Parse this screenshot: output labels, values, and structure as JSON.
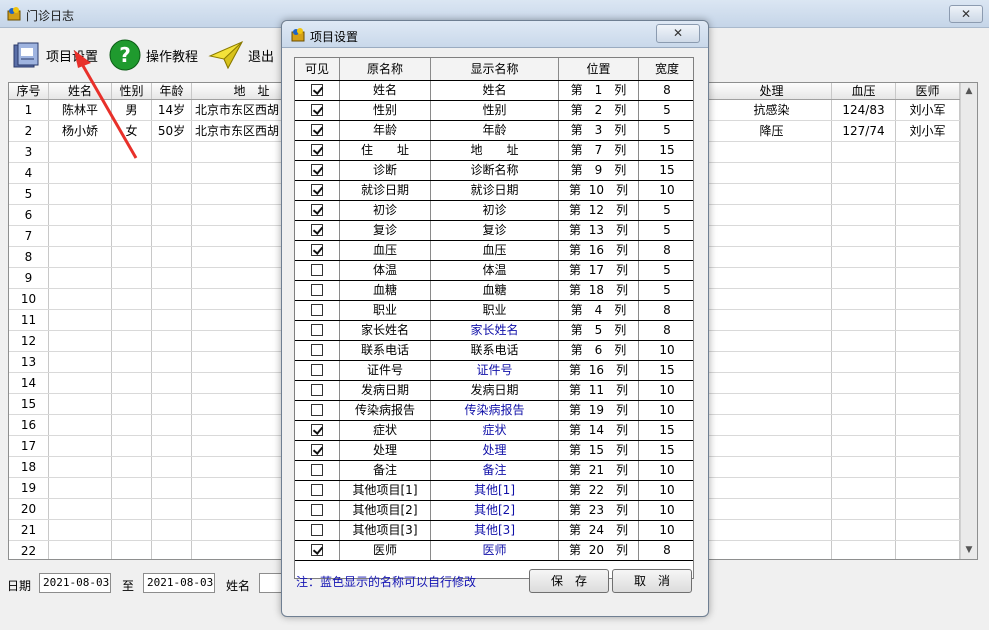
{
  "window": {
    "title": "门诊日志",
    "close_label": "✕"
  },
  "toolbar": [
    {
      "label": "项目设置"
    },
    {
      "label": "操作教程"
    },
    {
      "label": "退出"
    }
  ],
  "grid": {
    "headers": [
      "序号",
      "姓名",
      "性别",
      "年龄",
      "地　址",
      "处理",
      "血压",
      "医师"
    ],
    "rows": [
      {
        "no": "1",
        "name": "陈林平",
        "sex": "男",
        "age": "14岁",
        "address": "北京市东区西胡",
        "treatment": "抗感染",
        "bp": "124/83",
        "doctor": "刘小军"
      },
      {
        "no": "2",
        "name": "杨小娇",
        "sex": "女",
        "age": "50岁",
        "address": "北京市东区西胡",
        "treatment": "降压",
        "bp": "127/74",
        "doctor": "刘小军"
      },
      {
        "no": "3"
      },
      {
        "no": "4"
      },
      {
        "no": "5"
      },
      {
        "no": "6"
      },
      {
        "no": "7"
      },
      {
        "no": "8"
      },
      {
        "no": "9"
      },
      {
        "no": "10"
      },
      {
        "no": "11"
      },
      {
        "no": "12"
      },
      {
        "no": "13"
      },
      {
        "no": "14"
      },
      {
        "no": "15"
      },
      {
        "no": "16"
      },
      {
        "no": "17"
      },
      {
        "no": "18"
      },
      {
        "no": "19"
      },
      {
        "no": "20"
      },
      {
        "no": "21"
      },
      {
        "no": "22"
      }
    ]
  },
  "filter": {
    "date_label": "日期",
    "date_from": "2021-08-03",
    "to_label": "至",
    "date_to": "2021-08-03",
    "name_label": "姓名",
    "name_value": ""
  },
  "dialog": {
    "title": "项目设置",
    "close_label": "✕",
    "headers": [
      "可见",
      "原名称",
      "显示名称",
      "位置",
      "宽度"
    ],
    "items": [
      {
        "visible": true,
        "original": "姓名",
        "display": "姓名",
        "custom": false,
        "position": "第　1　列",
        "width": "8"
      },
      {
        "visible": true,
        "original": "性别",
        "display": "性别",
        "custom": false,
        "position": "第　2　列",
        "width": "5"
      },
      {
        "visible": true,
        "original": "年龄",
        "display": "年龄",
        "custom": false,
        "position": "第　3　列",
        "width": "5"
      },
      {
        "visible": true,
        "original": "住　　址",
        "display": "地　　址",
        "custom": false,
        "position": "第　7　列",
        "width": "15"
      },
      {
        "visible": true,
        "original": "诊断",
        "display": "诊断名称",
        "custom": false,
        "position": "第　9　列",
        "width": "15"
      },
      {
        "visible": true,
        "original": "就诊日期",
        "display": "就诊日期",
        "custom": false,
        "position": "第 10　列",
        "width": "10"
      },
      {
        "visible": true,
        "original": "初诊",
        "display": "初诊",
        "custom": false,
        "position": "第 12　列",
        "width": "5"
      },
      {
        "visible": true,
        "original": "复诊",
        "display": "复诊",
        "custom": false,
        "position": "第 13　列",
        "width": "5"
      },
      {
        "visible": true,
        "original": "血压",
        "display": "血压",
        "custom": false,
        "position": "第 16　列",
        "width": "8"
      },
      {
        "visible": false,
        "original": "体温",
        "display": "体温",
        "custom": false,
        "position": "第 17　列",
        "width": "5"
      },
      {
        "visible": false,
        "original": "血糖",
        "display": "血糖",
        "custom": false,
        "position": "第 18　列",
        "width": "5"
      },
      {
        "visible": false,
        "original": "职业",
        "display": "职业",
        "custom": false,
        "position": "第　4　列",
        "width": "8"
      },
      {
        "visible": false,
        "original": "家长姓名",
        "display": "家长姓名",
        "custom": true,
        "position": "第　5　列",
        "width": "8"
      },
      {
        "visible": false,
        "original": "联系电话",
        "display": "联系电话",
        "custom": false,
        "position": "第　6　列",
        "width": "10"
      },
      {
        "visible": false,
        "original": "证件号",
        "display": "证件号",
        "custom": true,
        "position": "第 16　列",
        "width": "15"
      },
      {
        "visible": false,
        "original": "发病日期",
        "display": "发病日期",
        "custom": false,
        "position": "第 11　列",
        "width": "10"
      },
      {
        "visible": false,
        "original": "传染病报告",
        "display": "传染病报告",
        "custom": true,
        "position": "第 19　列",
        "width": "10"
      },
      {
        "visible": true,
        "original": "症状",
        "display": "症状",
        "custom": true,
        "position": "第 14　列",
        "width": "15"
      },
      {
        "visible": true,
        "original": "处理",
        "display": "处理",
        "custom": true,
        "position": "第 15　列",
        "width": "15"
      },
      {
        "visible": false,
        "original": "备注",
        "display": "备注",
        "custom": true,
        "position": "第 21　列",
        "width": "10"
      },
      {
        "visible": false,
        "original": "其他项目[1]",
        "display": "其他[1]",
        "custom": true,
        "position": "第 22　列",
        "width": "10"
      },
      {
        "visible": false,
        "original": "其他项目[2]",
        "display": "其他[2]",
        "custom": true,
        "position": "第 23　列",
        "width": "10"
      },
      {
        "visible": false,
        "original": "其他项目[3]",
        "display": "其他[3]",
        "custom": true,
        "position": "第 24　列",
        "width": "10"
      },
      {
        "visible": true,
        "original": "医师",
        "display": "医师",
        "custom": true,
        "position": "第 20　列",
        "width": "8"
      }
    ],
    "note": "注：蓝色显示的名称可以自行修改",
    "save_label": "保　存",
    "cancel_label": "取　消"
  },
  "colors": {
    "custom_name": "#1010a8",
    "note": "#1414b4",
    "arrow": "#e8302a"
  }
}
